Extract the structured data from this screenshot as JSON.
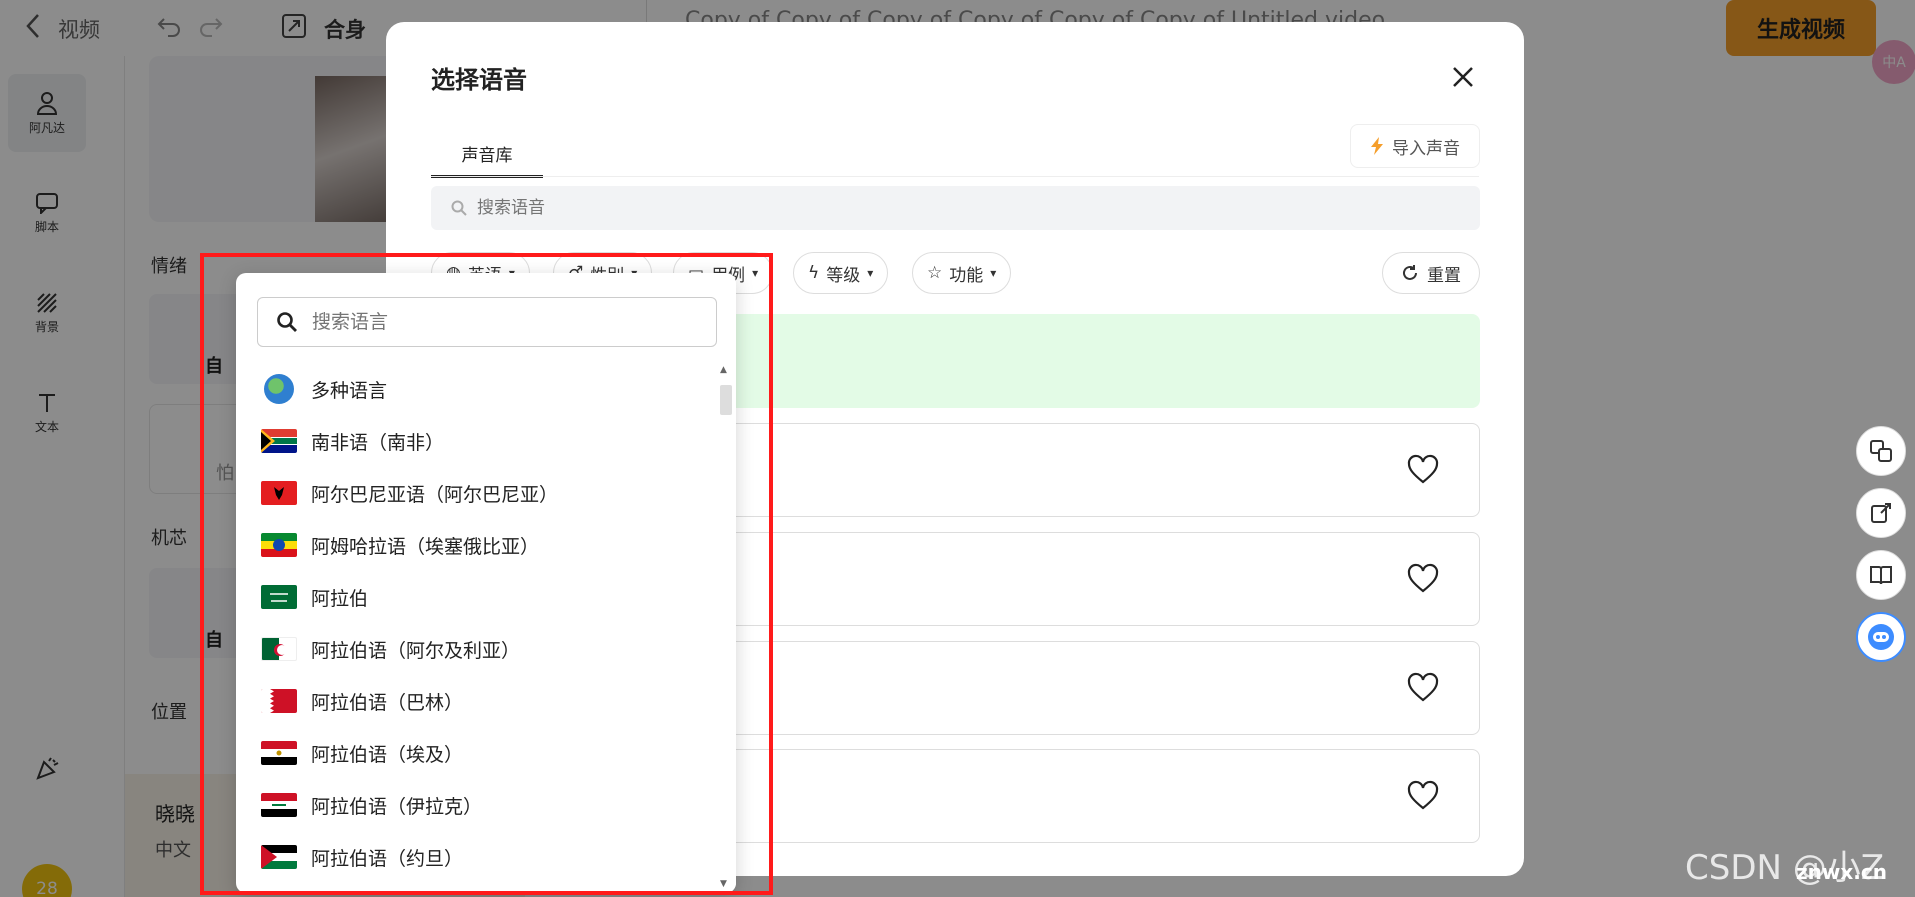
{
  "topbar": {
    "back_label": "视频",
    "aspect_label": "合身",
    "project_title": "Copy of Copy of Copy of Copy of Copy of Copy of Untitled video",
    "generate_button": "生成视频",
    "translate_badge": "中A"
  },
  "rail": {
    "items": [
      {
        "label": "阿凡达",
        "icon": "person-icon"
      },
      {
        "label": "脚本",
        "icon": "chat-icon"
      },
      {
        "label": "背景",
        "icon": "hatch-icon"
      },
      {
        "label": "文本",
        "icon": "text-icon"
      }
    ],
    "avatar_count": "28"
  },
  "panel": {
    "emotion_label": "情绪",
    "engine_label": "机芯",
    "position_label": "位置",
    "option_a_text": "自",
    "option_b_text": "自",
    "option_c_text": "怕",
    "voice_name": "晓晓",
    "voice_language": "中文"
  },
  "modal": {
    "title": "选择语音",
    "tab_library": "声音库",
    "import_button": "导入声音",
    "search_placeholder": "搜索语音",
    "filters": [
      {
        "label": "英语"
      },
      {
        "label": "性别"
      },
      {
        "label": "用例"
      },
      {
        "label": "等级"
      },
      {
        "label": "功能"
      }
    ],
    "reset_button": "重置"
  },
  "language_dropdown": {
    "search_placeholder": "搜索语言",
    "options": [
      {
        "label": "多种语言",
        "flag": "globe-icon"
      },
      {
        "label": "南非语（南非）",
        "flag": "flag-za"
      },
      {
        "label": "阿尔巴尼亚语（阿尔巴尼亚）",
        "flag": "flag-al"
      },
      {
        "label": "阿姆哈拉语（埃塞俄比亚）",
        "flag": "flag-et"
      },
      {
        "label": "阿拉伯",
        "flag": "flag-sa"
      },
      {
        "label": "阿拉伯语（阿尔及利亚）",
        "flag": "flag-dz"
      },
      {
        "label": "阿拉伯语（巴林）",
        "flag": "flag-bh"
      },
      {
        "label": "阿拉伯语（埃及）",
        "flag": "flag-eg"
      },
      {
        "label": "阿拉伯语（伊拉克）",
        "flag": "flag-iq"
      },
      {
        "label": "阿拉伯语（约旦）",
        "flag": "flag-jo"
      }
    ]
  },
  "watermark": {
    "text": "CSDN @小Z",
    "site": "znwx.cn"
  },
  "colors": {
    "accent_orange": "#f59e2b",
    "highlight_red": "#ff1a1a",
    "banner_green": "#e3fbe6"
  }
}
